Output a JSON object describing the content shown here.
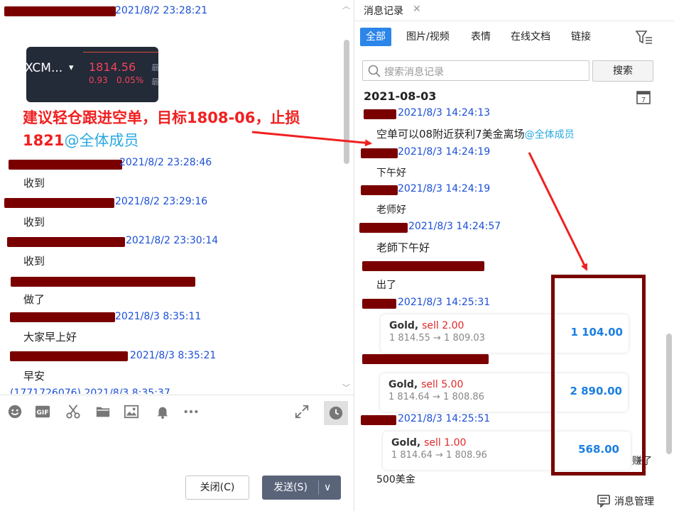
{
  "left_chat": {
    "ticker": {
      "symbol": "XCM...",
      "caret": "▾",
      "price": "1814.56",
      "change": "0.93",
      "change_pct": "0.05%",
      "tail_1": "最",
      "tail_2": "最"
    },
    "annotation": {
      "text": "建议轻仓跟进空单，目标1808-06，止损1821",
      "mention": "@全体成员"
    },
    "messages": [
      {
        "time": "2021/8/2 23:28:21",
        "text": ""
      },
      {
        "time": "2021/8/2 23:28:46",
        "text": "收到"
      },
      {
        "time": "2021/8/2 23:29:16",
        "text": "收到"
      },
      {
        "time": "2021/8/2 23:30:14",
        "text": "收到"
      },
      {
        "time": "",
        "text": "做了"
      },
      {
        "time": "2021/8/3 8:35:11",
        "text": "大家早上好"
      },
      {
        "time": "2021/8/3 8:35:21",
        "text": "早安"
      },
      {
        "time": "(1771726076) 2021/8/3 8:35:37",
        "text": ""
      }
    ],
    "toolbar_icons": [
      "emoji-icon",
      "gif-icon",
      "scissors-icon",
      "folder-icon",
      "image-icon",
      "bell-icon",
      "more-icon",
      "expand-icon",
      "history-clock-icon"
    ],
    "gif_label": "GIF",
    "close_button": "关闭(C)",
    "send_button": "发送(S)",
    "send_arrow": "∨"
  },
  "history": {
    "tab_title": "消息记录",
    "tab_close": "✕",
    "filters": [
      "全部",
      "图片/视频",
      "表情",
      "在线文档",
      "链接"
    ],
    "active_filter": "全部",
    "search_placeholder": "搜索消息记录",
    "search_button": "搜索",
    "date_header": "2021-08-03",
    "messages": [
      {
        "time": "2021/8/3 14:24:13",
        "text": "空单可以08附近获利7美金离场",
        "mention": "@全体成员"
      },
      {
        "time": "2021/8/3 14:24:19",
        "text": "下午好"
      },
      {
        "time": "2021/8/3 14:24:19",
        "text": "老师好"
      },
      {
        "time": "2021/8/3 14:24:57",
        "text": "老師下午好"
      },
      {
        "time": "",
        "text": "出了"
      },
      {
        "time": "2021/8/3 14:25:31",
        "text": ""
      },
      {
        "time": "",
        "text": ""
      },
      {
        "time": "2021/8/3 14:25:51",
        "text": "赚了"
      }
    ],
    "trade_cards": [
      {
        "asset": "Gold,",
        "side": "sell 2.00",
        "route": "1 814.55 → 1 809.03",
        "pnl": "1 104.00"
      },
      {
        "asset": "Gold,",
        "side": "sell 5.00",
        "route": "1 814.64 → 1 808.86",
        "pnl": "2 890.00"
      },
      {
        "asset": "Gold,",
        "side": "sell 1.00",
        "route": "1 814.64 → 1 808.96",
        "pnl": "568.00"
      }
    ],
    "footer_text": "500美金",
    "manage_label": "消息管理"
  },
  "colors": {
    "accent_blue": "#2c85e8",
    "timestamp_blue": "#1b4fd6",
    "redaction": "#7a0000",
    "annotation_red": "#f02020",
    "mention_blue": "#29a9e1"
  }
}
